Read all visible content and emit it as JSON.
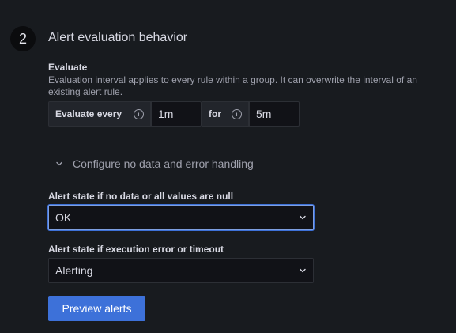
{
  "section": {
    "step_number": "2",
    "title": "Alert evaluation behavior"
  },
  "evaluate": {
    "label": "Evaluate",
    "description": "Evaluation interval applies to every rule within a group. It can overwrite the interval of an existing alert rule.",
    "every_label": "Evaluate every",
    "every_value": "1m",
    "for_label": "for",
    "for_value": "5m",
    "info_icon": "info-icon"
  },
  "no_data_handling": {
    "toggle_label": "Configure no data and error handling",
    "toggle_icon": "chevron-down-icon",
    "expanded": true,
    "no_data_label": "Alert state if no data or all values are null",
    "no_data_value": "OK",
    "error_label": "Alert state if execution error or timeout",
    "error_value": "Alerting"
  },
  "actions": {
    "preview_label": "Preview alerts"
  },
  "colors": {
    "background": "#181b1f",
    "accent": "#3d71d9",
    "focus_border": "#7e9fe0"
  }
}
